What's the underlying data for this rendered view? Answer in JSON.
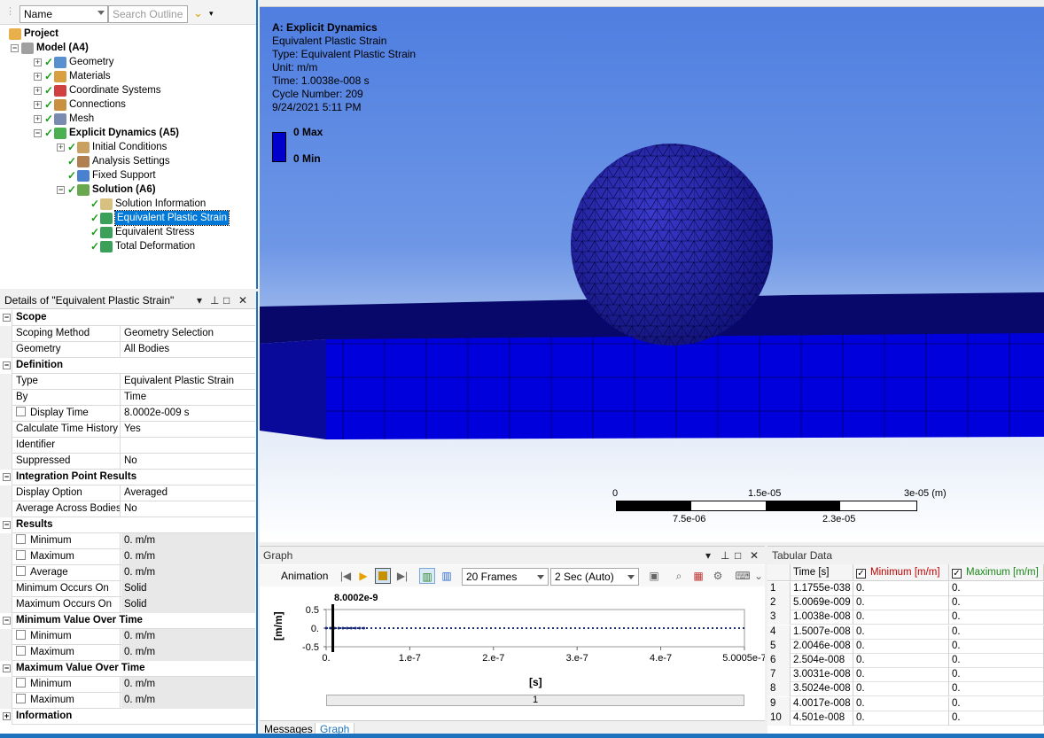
{
  "outline": {
    "name_combo": "Name",
    "search_placeholder": "Search Outline",
    "tree": [
      {
        "label": "Project"
      },
      {
        "label": "Model (A4)"
      },
      {
        "label": "Geometry"
      },
      {
        "label": "Materials"
      },
      {
        "label": "Coordinate Systems"
      },
      {
        "label": "Connections"
      },
      {
        "label": "Mesh"
      },
      {
        "label": "Explicit Dynamics (A5)"
      },
      {
        "label": "Initial Conditions"
      },
      {
        "label": "Analysis Settings"
      },
      {
        "label": "Fixed Support"
      },
      {
        "label": "Solution (A6)"
      },
      {
        "label": "Solution Information"
      },
      {
        "label": "Equivalent Plastic Strain"
      },
      {
        "label": "Equivalent Stress"
      },
      {
        "label": "Total Deformation"
      }
    ]
  },
  "details": {
    "title": "Details of \"Equivalent Plastic Strain\"",
    "rows": [
      {
        "label": "Scope",
        "value": ""
      },
      {
        "label": "Scoping Method",
        "value": "Geometry Selection"
      },
      {
        "label": "Geometry",
        "value": "All Bodies"
      },
      {
        "label": "Definition",
        "value": ""
      },
      {
        "label": "Type",
        "value": "Equivalent Plastic Strain"
      },
      {
        "label": "By",
        "value": "Time"
      },
      {
        "label": "Display Time",
        "value": "8.0002e-009 s"
      },
      {
        "label": "Calculate Time History",
        "value": "Yes"
      },
      {
        "label": "Identifier",
        "value": ""
      },
      {
        "label": "Suppressed",
        "value": "No"
      },
      {
        "label": "Integration Point Results",
        "value": ""
      },
      {
        "label": "Display Option",
        "value": "Averaged"
      },
      {
        "label": "Average Across Bodies",
        "value": "No"
      },
      {
        "label": "Results",
        "value": ""
      },
      {
        "label": "Minimum",
        "value": "0. m/m"
      },
      {
        "label": "Maximum",
        "value": "0. m/m"
      },
      {
        "label": "Average",
        "value": "0. m/m"
      },
      {
        "label": "Minimum Occurs On",
        "value": "Solid"
      },
      {
        "label": "Maximum Occurs On",
        "value": "Solid"
      },
      {
        "label": "Minimum Value Over Time",
        "value": ""
      },
      {
        "label": "Minimum",
        "value": "0. m/m"
      },
      {
        "label": "Maximum",
        "value": "0. m/m"
      },
      {
        "label": "Maximum Value Over Time",
        "value": ""
      },
      {
        "label": "Minimum",
        "value": "0. m/m"
      },
      {
        "label": "Maximum",
        "value": "0. m/m"
      },
      {
        "label": "Information",
        "value": ""
      }
    ]
  },
  "viewport": {
    "info_title": "A: Explicit Dynamics",
    "info_lines": [
      "Equivalent Plastic Strain",
      "Type: Equivalent Plastic Strain",
      "Unit: m/m",
      "Time: 1.0038e-008 s",
      "Cycle Number: 209",
      "9/24/2021 5:11 PM"
    ],
    "legend_max": "0 Max",
    "legend_min": "0 Min",
    "legend_color": "#0000cc",
    "scale_labels_top": [
      "0",
      "1.5e-05",
      "3e-05 (m)"
    ],
    "scale_labels_bottom": [
      "7.5e-06",
      "2.3e-05"
    ]
  },
  "graph": {
    "title": "Graph",
    "animation_label": "Animation",
    "frames": "20 Frames",
    "duration": "2 Sec (Auto)",
    "marker_label": "8.0002e-9",
    "frame_number": "1",
    "tabs": [
      "Messages",
      "Graph"
    ]
  },
  "tabular": {
    "title": "Tabular Data",
    "headers": [
      "Time [s]",
      "Minimum [m/m]",
      "Maximum [m/m]"
    ],
    "rows": [
      [
        "1",
        "1.1755e-038",
        "0.",
        "0."
      ],
      [
        "2",
        "5.0069e-009",
        "0.",
        "0."
      ],
      [
        "3",
        "1.0038e-008",
        "0.",
        "0."
      ],
      [
        "4",
        "1.5007e-008",
        "0.",
        "0."
      ],
      [
        "5",
        "2.0046e-008",
        "0.",
        "0."
      ],
      [
        "6",
        "2.504e-008",
        "0.",
        "0."
      ],
      [
        "7",
        "3.0031e-008",
        "0.",
        "0."
      ],
      [
        "8",
        "3.5024e-008",
        "0.",
        "0."
      ],
      [
        "9",
        "4.0017e-008",
        "0.",
        "0."
      ],
      [
        "10",
        "4.501e-008",
        "0.",
        "0."
      ]
    ]
  },
  "chart_data": {
    "type": "line",
    "xlabel": "[s]",
    "ylabel": "[m/m]",
    "x_ticks": [
      "0.",
      "1.e-7",
      "2.e-7",
      "3.e-7",
      "4.e-7",
      "5.0005e-7"
    ],
    "y_ticks": [
      "0.5",
      "0.",
      "-0.5"
    ],
    "xlim": [
      0,
      5.0005e-07
    ],
    "ylim": [
      -0.5,
      0.5
    ],
    "series": [
      {
        "values_x": [
          1.1755e-38,
          5.0069e-09,
          1.0038e-08,
          1.5007e-08,
          2.0046e-08,
          2.504e-08,
          3.0031e-08,
          3.5024e-08,
          4.0017e-08,
          4.501e-08
        ],
        "values_y": [
          0,
          0,
          0,
          0,
          0,
          0,
          0,
          0,
          0,
          0
        ]
      }
    ],
    "marker_x": 8.0002e-09
  }
}
